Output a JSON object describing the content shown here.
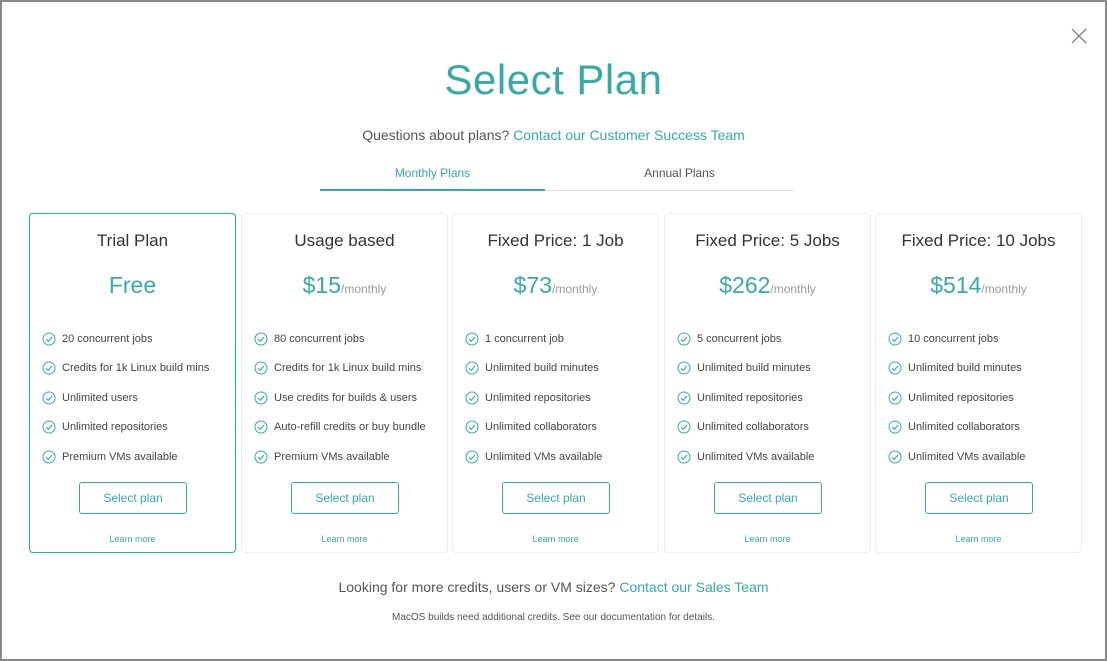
{
  "header": {
    "title": "Select Plan",
    "question_text": "Questions about plans?",
    "question_link": "Contact our Customer Success Team"
  },
  "tabs": [
    {
      "label": "Monthly Plans",
      "active": true
    },
    {
      "label": "Annual Plans",
      "active": false
    }
  ],
  "plans": [
    {
      "title": "Trial Plan",
      "price": "Free",
      "period": "",
      "selected": true,
      "features": [
        "20 concurrent jobs",
        "Credits for 1k Linux build mins",
        "Unlimited users",
        "Unlimited repositories",
        "Premium VMs available"
      ],
      "button": "Select plan",
      "learn_more": "Learn more"
    },
    {
      "title": "Usage based",
      "price": "$15",
      "period": "/monthly",
      "selected": false,
      "features": [
        "80 concurrent jobs",
        "Credits for 1k Linux build mins",
        "Use credits for builds & users",
        "Auto-refill credits or buy bundle",
        "Premium VMs available"
      ],
      "button": "Select plan",
      "learn_more": "Learn more"
    },
    {
      "title": "Fixed Price: 1 Job",
      "price": "$73",
      "period": "/monthly",
      "selected": false,
      "features": [
        "1 concurrent job",
        "Unlimited build minutes",
        "Unlimited repositories",
        "Unlimited collaborators",
        "Unlimited VMs available"
      ],
      "button": "Select plan",
      "learn_more": "Learn more"
    },
    {
      "title": "Fixed Price: 5 Jobs",
      "price": "$262",
      "period": "/monthly",
      "selected": false,
      "features": [
        "5 concurrent jobs",
        "Unlimited build minutes",
        "Unlimited repositories",
        "Unlimited collaborators",
        "Unlimited VMs available"
      ],
      "button": "Select plan",
      "learn_more": "Learn more"
    },
    {
      "title": "Fixed Price: 10 Jobs",
      "price": "$514",
      "period": "/monthly",
      "selected": false,
      "features": [
        "10 concurrent jobs",
        "Unlimited build minutes",
        "Unlimited repositories",
        "Unlimited collaborators",
        "Unlimited VMs available"
      ],
      "button": "Select plan",
      "learn_more": "Learn more"
    }
  ],
  "footer": {
    "question_text": "Looking for more credits, users or VM sizes?",
    "question_link": "Contact our Sales Team",
    "note": "MacOS builds need additional credits. See our documentation for details."
  },
  "icons": {
    "close": "close-icon",
    "feature": "check-circle-icon"
  },
  "colors": {
    "accent": "#39a9a6",
    "text": "#333333",
    "muted": "#9a9a9a",
    "border": "#eeeeee"
  }
}
